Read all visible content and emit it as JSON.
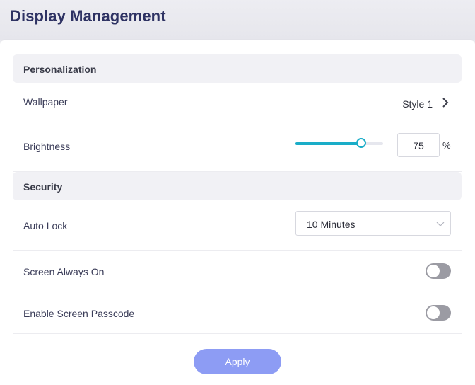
{
  "page": {
    "title": "Display Management"
  },
  "sections": {
    "personalization": "Personalization",
    "security": "Security"
  },
  "wallpaper": {
    "label": "Wallpaper",
    "value": "Style 1",
    "icon": "chevron-right-icon"
  },
  "brightness": {
    "label": "Brightness",
    "value": "75",
    "unit": "%",
    "level_percent": 75
  },
  "auto_lock": {
    "label": "Auto Lock",
    "selected": "10 Minutes",
    "icon": "chevron-down-icon"
  },
  "screen_always_on": {
    "label": "Screen Always On",
    "enabled": false
  },
  "screen_passcode": {
    "label": "Enable Screen Passcode",
    "enabled": false
  },
  "actions": {
    "apply_label": "Apply"
  },
  "colors": {
    "accent": "#1aadc8",
    "title": "#2e3263",
    "button": "#8d9cf4",
    "toggle_off": "#9b9ba3"
  }
}
